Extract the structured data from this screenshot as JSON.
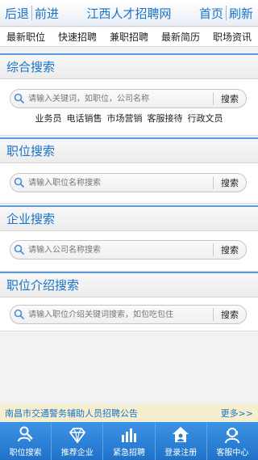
{
  "topbar": {
    "back": "后退",
    "forward": "前进",
    "title": "江西人才招聘网",
    "home": "首页",
    "refresh": "刷新"
  },
  "menu": {
    "items": [
      "最新职位",
      "快速招聘",
      "兼职招聘",
      "最新简历",
      "职场资讯"
    ]
  },
  "sections": {
    "general": {
      "title": "综合搜索",
      "placeholder": "请输入关键词，如职位，公司名称",
      "button": "搜索",
      "hotwords": [
        "业务员",
        "电话销售",
        "市场营销",
        "客服接待",
        "行政文员"
      ]
    },
    "job": {
      "title": "职位搜索",
      "placeholder": "请输入职位名称搜索",
      "button": "搜索"
    },
    "company": {
      "title": "企业搜索",
      "placeholder": "请输入公司名称搜索",
      "button": "搜索"
    },
    "jobdesc": {
      "title": "职位介绍搜索",
      "placeholder": "请输入职位介绍关键词搜索，如包吃包住",
      "button": "搜索"
    }
  },
  "notice": {
    "text": "南昌市交通警务辅助人员招聘公告",
    "more": "更多>>"
  },
  "tabbar": {
    "items": [
      {
        "label": "职位搜索",
        "icon": "person-search-icon"
      },
      {
        "label": "推荐企业",
        "icon": "diamond-icon"
      },
      {
        "label": "紧急招聘",
        "icon": "bar-chart-icon"
      },
      {
        "label": "登录注册",
        "icon": "house-user-icon"
      },
      {
        "label": "客服中心",
        "icon": "customer-service-icon"
      }
    ]
  },
  "colors": {
    "accent": "#1a73c7",
    "tabbar": "#2a80d6",
    "notice_bg": "#f6efcf"
  }
}
